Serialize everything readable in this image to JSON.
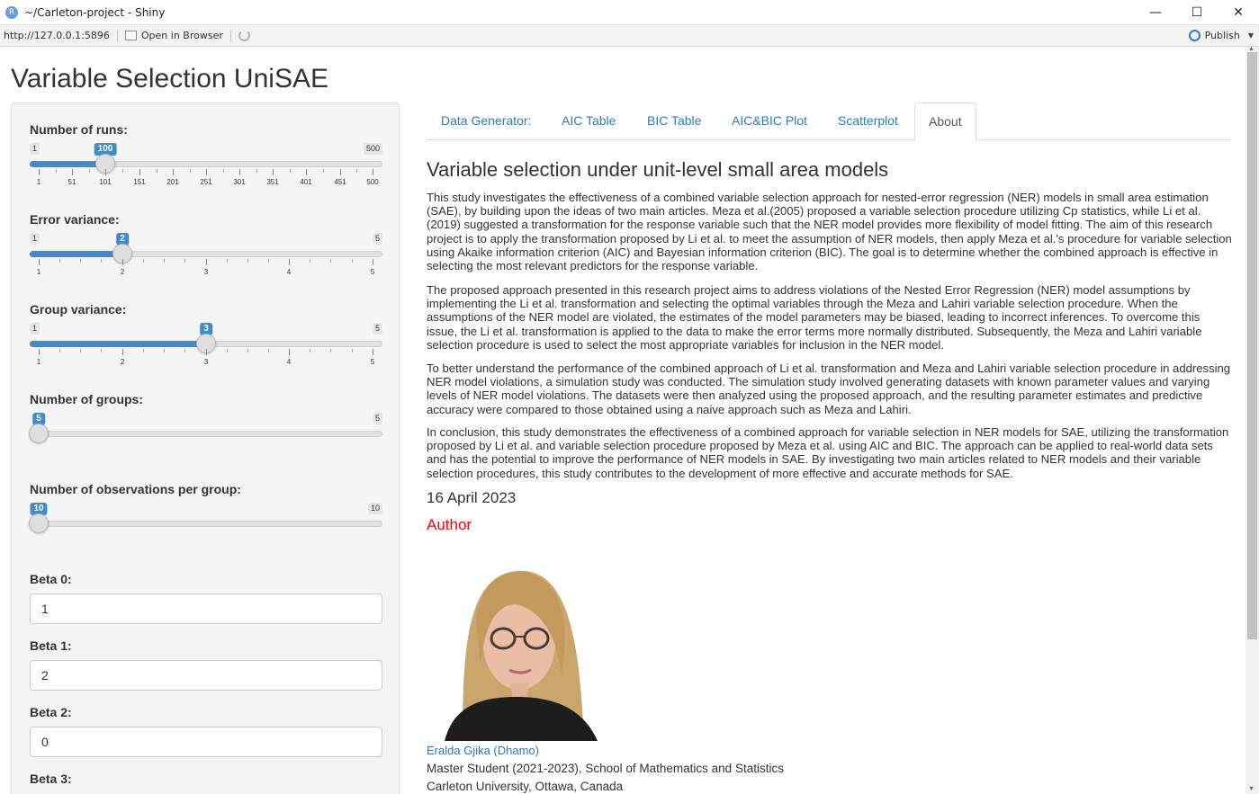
{
  "window": {
    "title": "~/Carleton-project - Shiny",
    "app_icon_letter": "R",
    "minimize": "—",
    "maximize": "☐",
    "close": "✕"
  },
  "addressbar": {
    "url": "http://127.0.0.1:5896",
    "open_in_browser": "Open in Browser",
    "publish": "Publish"
  },
  "app": {
    "title": "Variable Selection UniSAE"
  },
  "sidebar": {
    "runs": {
      "label": "Number of runs:",
      "min": "1",
      "max": "500",
      "value": "100",
      "ticks": [
        "1",
        "51",
        "101",
        "151",
        "201",
        "251",
        "301",
        "351",
        "401",
        "451",
        "500"
      ]
    },
    "error_variance": {
      "label": "Error variance:",
      "min": "1",
      "max": "5",
      "value": "2",
      "ticks": [
        "1",
        "2",
        "3",
        "4",
        "5"
      ]
    },
    "group_variance": {
      "label": "Group variance:",
      "min": "1",
      "max": "5",
      "value": "3",
      "ticks": [
        "1",
        "2",
        "3",
        "4",
        "5"
      ]
    },
    "num_groups": {
      "label": "Number of groups:",
      "max": "5",
      "value": "5"
    },
    "obs_per_group": {
      "label": "Number of observations per group:",
      "max": "10",
      "value": "10"
    },
    "beta0": {
      "label": "Beta 0:",
      "value": "1"
    },
    "beta1": {
      "label": "Beta 1:",
      "value": "2"
    },
    "beta2": {
      "label": "Beta 2:",
      "value": "0"
    },
    "beta3": {
      "label": "Beta 3:"
    }
  },
  "tabs": [
    {
      "label": "Data Generator:"
    },
    {
      "label": "AIC Table"
    },
    {
      "label": "BIC Table"
    },
    {
      "label": "AIC&BIC Plot"
    },
    {
      "label": "Scatterplot"
    },
    {
      "label": "About"
    }
  ],
  "about": {
    "heading": "Variable selection under unit-level small area models",
    "paragraphs": [
      "This study investigates the effectiveness of a combined variable selection approach for nested-error regression (NER) models in small area estimation (SAE), by building upon the ideas of two main articles. Meza et al.(2005) proposed a variable selection procedure utilizing Cp statistics, while Li et al. (2019) suggested a transformation for the response variable such that the NER model provides more flexibility of model fitting. The aim of this research project is to apply the transformation proposed by Li et al. to meet the assumption of NER models, then apply Meza et al.'s procedure for variable selection using Akaike information criterion (AIC) and Bayesian information criterion (BIC). The goal is to determine whether the combined approach is effective in selecting the most relevant predictors for the response variable.",
      "The proposed approach presented in this research project aims to address violations of the Nested Error Regression (NER) model assumptions by implementing the Li et al. transformation and selecting the optimal variables through the Meza and Lahiri variable selection procedure. When the assumptions of the NER model are violated, the estimates of the model parameters may be biased, leading to incorrect inferences. To overcome this issue, the Li et al. transformation is applied to the data to make the error terms more normally distributed. Subsequently, the Meza and Lahiri variable selection procedure is used to select the most appropriate variables for inclusion in the NER model.",
      "To better understand the performance of the combined approach of Li et al. transformation and Meza and Lahiri variable selection procedure in addressing NER model violations, a simulation study was conducted. The simulation study involved generating datasets with known parameter values and varying levels of NER model violations. The datasets were then analyzed using the proposed approach, and the resulting parameter estimates and predictive accuracy were compared to those obtained using a naive approach such as Meza and Lahiri.",
      "In conclusion, this study demonstrates the effectiveness of a combined approach for variable selection in NER models for SAE, utilizing the transformation proposed by Li et al. and variable selection procedure proposed by Meza et al. using AIC and BIC. The approach can be applied to real-world data sets and has the potential to improve the performance of NER models in SAE. By investigating two main articles related to NER models and their variable selection procedures, this study contributes to the development of more effective and accurate methods for SAE."
    ],
    "date": "16 April 2023",
    "author_heading": "Author",
    "author_name": "Eralda Gjika (Dhamo)",
    "author_lines": [
      "Master Student (2021-2023), School of Mathematics and Statistics",
      "Carleton University, Ottawa, Canada"
    ]
  },
  "colors": {
    "accent": "#428bca",
    "link": "#337ab7",
    "author_heading": "#ff0000"
  }
}
